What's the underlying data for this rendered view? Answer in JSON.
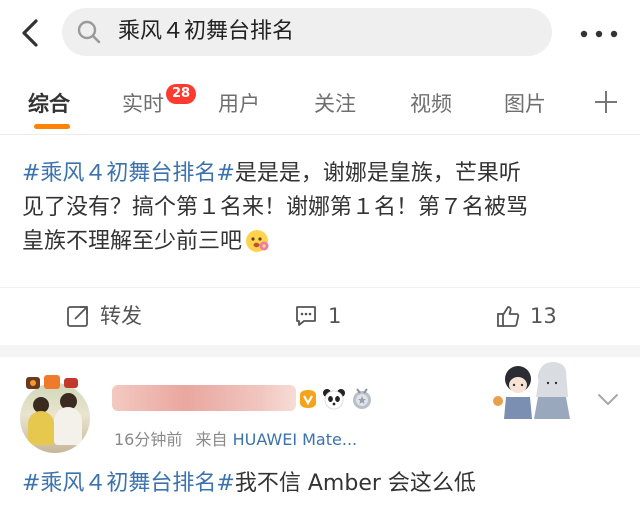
{
  "search": {
    "query": "乘风４初舞台排名"
  },
  "tabs": [
    {
      "label": "综合",
      "active": true
    },
    {
      "label": "实时",
      "badge": "28"
    },
    {
      "label": "用户"
    },
    {
      "label": "关注"
    },
    {
      "label": "视频"
    },
    {
      "label": "图片"
    }
  ],
  "colors": {
    "accent": "#ff8200",
    "link": "#3c72ad",
    "badge": "#ff3b30"
  },
  "post1": {
    "hashtag": "#乘风４初舞台排名#",
    "line1_rest": "是是是，谢娜是皇族，芒果听",
    "line2": "见了没有？搞个第１名来！谢娜第１名！第７名被骂",
    "line3": "皇族不理解至少前三吧",
    "emoji": "flower-face-emoji",
    "actions": {
      "repost_label": "转发",
      "comment_count": "1",
      "like_count": "13"
    }
  },
  "post2": {
    "meta_time": "16分钟前",
    "meta_from": "来自",
    "meta_source": "HUAWEI Mate...",
    "hashtag": "#乘风４初舞台排名#",
    "text": "我不信 Amber 会这么低"
  }
}
